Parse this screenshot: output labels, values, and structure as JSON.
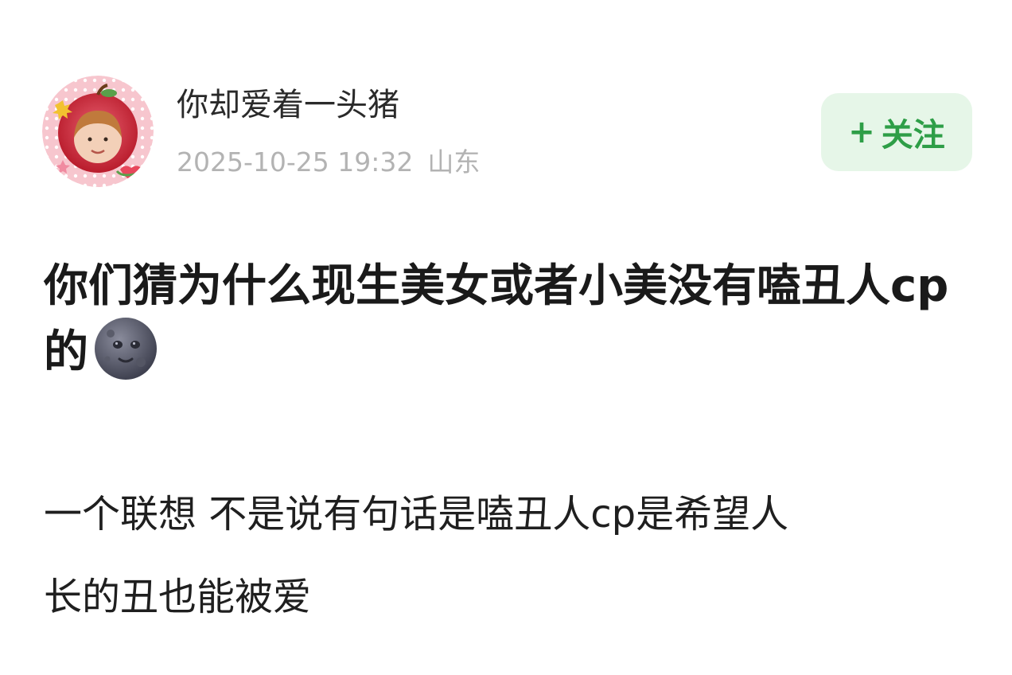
{
  "post": {
    "author": {
      "name": "你却爱着一头猪",
      "avatar_icon": "apple-frame-avatar"
    },
    "timestamp": "2025-10-25 19:32",
    "location": "山东",
    "follow_button": {
      "plus": "+",
      "label": "关注"
    },
    "title": "你们猜为什么现生美女或者小美没有嗑丑人cp的",
    "title_emoji": "new-moon-face-icon",
    "body_lines": [
      "一个联想 不是说有句话是嗑丑人cp是希望人",
      "长的丑也能被爱"
    ]
  },
  "colors": {
    "follow_bg": "#e6f6e8",
    "follow_text": "#2e9e47",
    "meta_text": "#b3b3b3"
  }
}
